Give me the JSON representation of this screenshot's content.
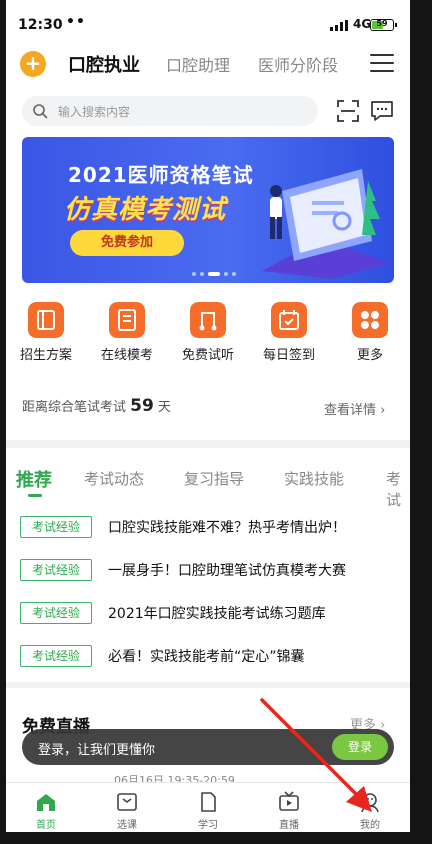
{
  "status": {
    "time": "12:30",
    "dots": "••",
    "network": "4G",
    "battery": "59"
  },
  "nav": {
    "tabs": [
      {
        "label": "口腔执业"
      },
      {
        "label": "口腔助理"
      },
      {
        "label": "医师分阶段"
      }
    ]
  },
  "search": {
    "placeholder": "输入搜索内容"
  },
  "banner": {
    "line1": "2021医师资格笔试",
    "line2": "仿真模考测试",
    "button": "免费参加"
  },
  "quick": [
    {
      "label": "招生方案",
      "icon": "book-icon"
    },
    {
      "label": "在线模考",
      "icon": "exam-icon"
    },
    {
      "label": "免费试听",
      "icon": "music-icon"
    },
    {
      "label": "每日签到",
      "icon": "calendar-check-icon"
    },
    {
      "label": "更多",
      "icon": "more-grid-icon"
    }
  ],
  "countdown": {
    "prefix": "距离综合笔试考试",
    "days": "59",
    "suffix": "天",
    "detail": "查看详情"
  },
  "news": {
    "tabs": [
      {
        "label": "推荐"
      },
      {
        "label": "考试动态"
      },
      {
        "label": "复习指导"
      },
      {
        "label": "实践技能"
      },
      {
        "label": "考试"
      }
    ],
    "items": [
      {
        "tag": "考试经验",
        "title": "口腔实践技能难不难？热乎考情出炉！"
      },
      {
        "tag": "考试经验",
        "title": "一展身手！口腔助理笔试仿真模考大赛"
      },
      {
        "tag": "考试经验",
        "title": "2021年口腔实践技能考试练习题库"
      },
      {
        "tag": "考试经验",
        "title": "必看！实践技能考前“定心”锦囊"
      }
    ]
  },
  "live": {
    "title": "免费直播",
    "more": "更多",
    "time": "06月16日 19:35-20:59"
  },
  "toast": {
    "text": "登录，让我们更懂你",
    "button": "登录"
  },
  "tabbar": [
    {
      "label": "首页",
      "icon": "home-icon"
    },
    {
      "label": "选课",
      "icon": "course-icon"
    },
    {
      "label": "学习",
      "icon": "study-icon"
    },
    {
      "label": "直播",
      "icon": "live-tv-icon"
    },
    {
      "label": "我的",
      "icon": "profile-icon"
    }
  ],
  "colors": {
    "accent": "#2fa84f",
    "orange": "#f46d2b",
    "banner": "#3a56e6",
    "login": "#7bc642"
  }
}
